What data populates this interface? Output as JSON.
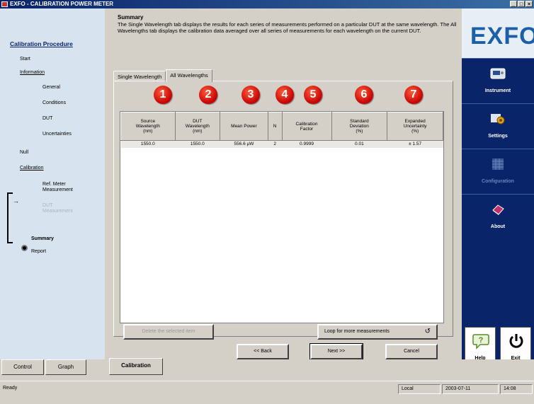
{
  "window": {
    "title": "EXFO - CALIBRATION POWER METER",
    "buttons": [
      "_",
      "□",
      "×"
    ]
  },
  "procedure": {
    "heading": "Calibration Procedure",
    "items": [
      {
        "label": "Start"
      },
      {
        "label": "Information"
      },
      {
        "label": "General"
      },
      {
        "label": "Conditions"
      },
      {
        "label": "DUT"
      },
      {
        "label": "Uncertainties"
      },
      {
        "label": "Null"
      },
      {
        "label": "Calibration"
      },
      {
        "label": "Ref. Meter Measurement"
      },
      {
        "label": "DUT Measurement"
      },
      {
        "label": "Summary"
      },
      {
        "label": "Report"
      }
    ]
  },
  "summary": {
    "title": "Summary",
    "text": "The Single Wavelength tab displays the results for each series of measurements performed on a particular DUT at the same wavelength. The All Wavelengths tab displays the calibration data averaged over all series of measurements for each wavelength on the current DUT."
  },
  "tabs": [
    {
      "label": "Single Wavelength"
    },
    {
      "label": "All Wavelengths"
    }
  ],
  "markers": [
    "1",
    "2",
    "3",
    "4",
    "5",
    "6",
    "7"
  ],
  "table": {
    "columns": [
      "Source\nWavelength\n(nm)",
      "DUT\nWavelength\n(nm)",
      "Mean Power",
      "N",
      "Calibration\nFactor",
      "Standard\nDeviation\n(%)",
      "Expanded\nUncertainty\n(%)"
    ],
    "rows": [
      [
        "1550.0",
        "1550.0",
        "556.6 µW",
        "2",
        "0.9999",
        "0.01",
        "± 1.57"
      ]
    ]
  },
  "buttons": {
    "delete": "Delete the selected item",
    "loop": "Loop for more measurements",
    "back": "<< Back",
    "next": "Next >>",
    "cancel": "Cancel"
  },
  "sidebar": {
    "logo": "EXFO",
    "nav": [
      {
        "label": "Instrument",
        "icon": "instrument-icon"
      },
      {
        "label": "Settings",
        "icon": "settings-icon"
      },
      {
        "label": "Configuration",
        "icon": "configuration-icon"
      },
      {
        "label": "About",
        "icon": "about-icon"
      }
    ],
    "help": "Help",
    "exit": "Exit"
  },
  "bottom_tabs": [
    {
      "label": "Control"
    },
    {
      "label": "Graph"
    },
    {
      "label": "Calibration"
    }
  ],
  "status": {
    "ready": "Ready",
    "mode": "Local",
    "date": "2003-07-11",
    "time": "14:08"
  },
  "colors": {
    "sidebar_bg": "#0a246a",
    "marker": "#d10000",
    "logo": "#1a5fa8"
  }
}
